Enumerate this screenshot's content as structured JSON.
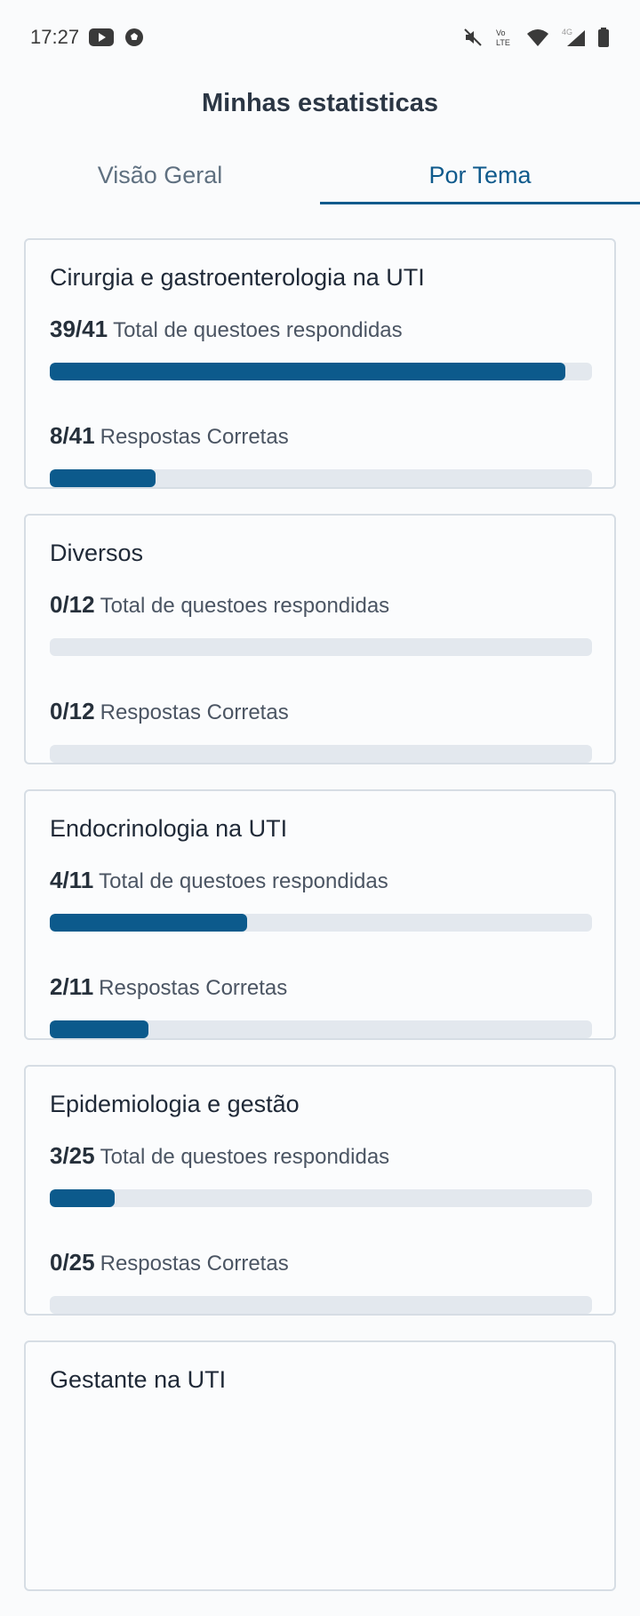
{
  "status_bar": {
    "time": "17:27",
    "icons_left": [
      "youtube-icon",
      "soccer-ball-icon"
    ],
    "icons_right": [
      "mute-icon",
      "volte-icon",
      "wifi-icon",
      "4g-signal-icon",
      "battery-icon"
    ],
    "volte_text": "Vo LTE",
    "network_text": "4G"
  },
  "header": {
    "title": "Minhas estatisticas"
  },
  "tabs": [
    {
      "label": "Visão Geral",
      "active": false
    },
    {
      "label": "Por Tema",
      "active": true
    }
  ],
  "cards": [
    {
      "title": "Cirurgia e gastroenterologia na UTI",
      "answered": {
        "count": "39/41",
        "label": "Total de questoes respondidas",
        "progress": 0.951
      },
      "correct": {
        "count": "8/41",
        "label": "Respostas Corretas",
        "progress": 0.195
      }
    },
    {
      "title": "Diversos",
      "answered": {
        "count": "0/12",
        "label": "Total de questoes respondidas",
        "progress": 0
      },
      "correct": {
        "count": "0/12",
        "label": "Respostas Corretas",
        "progress": 0
      }
    },
    {
      "title": "Endocrinologia na UTI",
      "answered": {
        "count": "4/11",
        "label": "Total de questoes respondidas",
        "progress": 0.364
      },
      "correct": {
        "count": "2/11",
        "label": "Respostas Corretas",
        "progress": 0.182
      }
    },
    {
      "title": "Epidemiologia e gestão",
      "answered": {
        "count": "3/25",
        "label": "Total de questoes respondidas",
        "progress": 0.12
      },
      "correct": {
        "count": "0/25",
        "label": "Respostas Corretas",
        "progress": 0
      }
    },
    {
      "title": "Gestante na UTI"
    }
  ],
  "colors": {
    "accent": "#0c5a8c",
    "track": "#e3e8ee",
    "tab_inactive": "#5f7080"
  }
}
